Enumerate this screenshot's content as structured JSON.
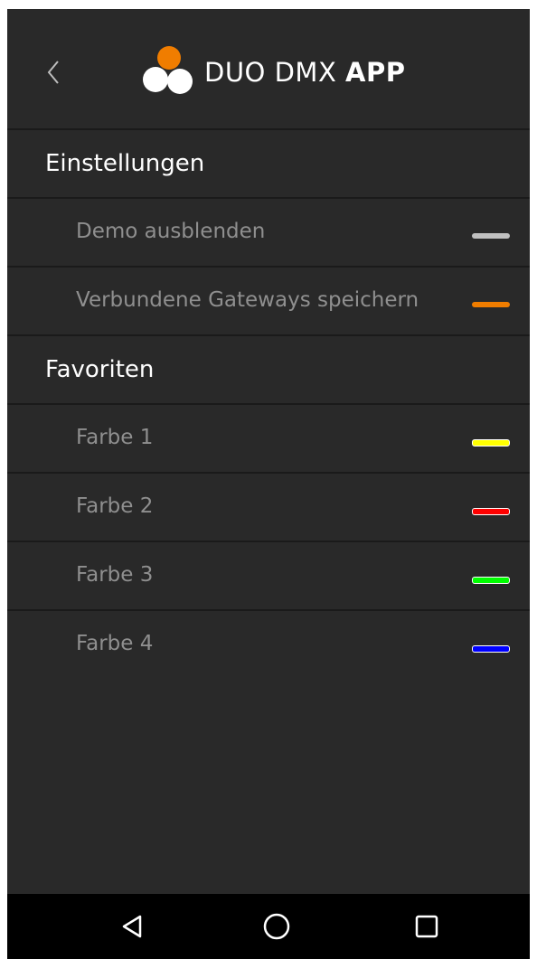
{
  "header": {
    "back_icon": "chevron-left-icon",
    "logo_icon": "duo-dmx-logo",
    "title_regular": "DUO DMX ",
    "title_bold": "APP"
  },
  "sections": [
    {
      "label": "Einstellungen",
      "items": [
        {
          "label": "Demo ausblenden",
          "color": "#c0c0c0"
        },
        {
          "label": "Verbundene Gateways speichern",
          "color": "#f07d00"
        }
      ]
    },
    {
      "label": "Favoriten",
      "items": [
        {
          "label": "Farbe 1",
          "color": "#ffff00"
        },
        {
          "label": "Farbe 2",
          "color": "#ff0000"
        },
        {
          "label": "Farbe 3",
          "color": "#00ff00"
        },
        {
          "label": "Farbe 4",
          "color": "#0000ff"
        }
      ]
    }
  ],
  "navbar": {
    "back_icon": "triangle-back-icon",
    "home_icon": "circle-home-icon",
    "recents_icon": "square-recents-icon"
  },
  "colors": {
    "background": "#292929",
    "divider": "#1a1a1a",
    "accent_orange": "#f07d00"
  }
}
